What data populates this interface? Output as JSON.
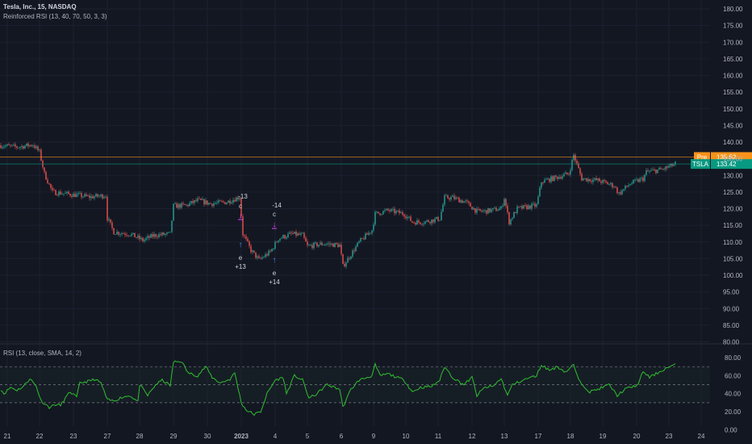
{
  "header": {
    "symbol_line": "Tesla, Inc., 15, NASDAQ",
    "indicator_line": "Reinforced RSI (13, 40, 70, 50, 3, 3)"
  },
  "rsi_pane": {
    "label": "RSI (13, close, SMA, 14, 2)"
  },
  "colors": {
    "background": "#131722",
    "up": "#26a69a",
    "down": "#ef5350",
    "rsi": "#2fbf2f",
    "pre": "#f7931a",
    "last": "#089981",
    "bear_arrow": "#e040fb",
    "bull_arrow": "#448aff"
  },
  "chart_data": [
    {
      "type": "candlestick",
      "title": "Tesla, Inc., 15, NASDAQ",
      "ylim": [
        80,
        180
      ],
      "y_ticks": [
        "180.00",
        "175.00",
        "170.00",
        "165.00",
        "160.00",
        "155.00",
        "150.00",
        "145.00",
        "140.00",
        "135.00",
        "130.00",
        "125.00",
        "120.00",
        "115.00",
        "110.00",
        "105.00",
        "100.00",
        "95.00",
        "90.00",
        "85.00",
        "80.00"
      ],
      "y_tick_values": [
        180,
        175,
        170,
        165,
        160,
        155,
        150,
        145,
        140,
        135,
        130,
        125,
        120,
        115,
        110,
        105,
        100,
        95,
        90,
        85,
        80
      ],
      "x_ticks": [
        "21",
        "22",
        "23",
        "27",
        "28",
        "29",
        "30",
        "2023",
        "4",
        "5",
        "6",
        "9",
        "10",
        "11",
        "12",
        "13",
        "17",
        "18",
        "19",
        "20",
        "23",
        "24"
      ],
      "x_tick_bars": [
        4,
        24,
        45,
        66,
        86,
        107,
        128,
        149,
        170,
        190,
        211,
        231,
        251,
        271,
        292,
        312,
        333,
        353,
        373,
        394,
        414,
        434
      ],
      "bars_total": 440,
      "close_anchors": [
        [
          0,
          139.0
        ],
        [
          10,
          138.5
        ],
        [
          20,
          139.2
        ],
        [
          24,
          137.0
        ],
        [
          27,
          130.5
        ],
        [
          32,
          125.0
        ],
        [
          40,
          124.5
        ],
        [
          48,
          124.0
        ],
        [
          55,
          123.5
        ],
        [
          65,
          124.0
        ],
        [
          66,
          117.2
        ],
        [
          70,
          113.0
        ],
        [
          80,
          112.4
        ],
        [
          88,
          110.5
        ],
        [
          95,
          112.0
        ],
        [
          105,
          112.4
        ],
        [
          107,
          120.8
        ],
        [
          115,
          121.0
        ],
        [
          122,
          122.5
        ],
        [
          130,
          121.5
        ],
        [
          140,
          122.0
        ],
        [
          148,
          123.5
        ],
        [
          150,
          112.4
        ],
        [
          155,
          107.5
        ],
        [
          160,
          104.6
        ],
        [
          167,
          107.0
        ],
        [
          172,
          111.0
        ],
        [
          180,
          112.4
        ],
        [
          187,
          112.0
        ],
        [
          190,
          108.7
        ],
        [
          200,
          109.5
        ],
        [
          210,
          109.0
        ],
        [
          212,
          102.7
        ],
        [
          218,
          107.0
        ],
        [
          222,
          109.9
        ],
        [
          230,
          113.6
        ],
        [
          232,
          118.4
        ],
        [
          240,
          119.5
        ],
        [
          250,
          118.4
        ],
        [
          255,
          116.0
        ],
        [
          262,
          116.0
        ],
        [
          272,
          117.0
        ],
        [
          275,
          123.3
        ],
        [
          280,
          123.3
        ],
        [
          288,
          122.0
        ],
        [
          295,
          119.2
        ],
        [
          300,
          119.2
        ],
        [
          310,
          120.0
        ],
        [
          312,
          123.3
        ],
        [
          315,
          116.0
        ],
        [
          320,
          120.0
        ],
        [
          332,
          121.0
        ],
        [
          335,
          128.1
        ],
        [
          345,
          129.5
        ],
        [
          352,
          130.5
        ],
        [
          355,
          136.1
        ],
        [
          360,
          129.0
        ],
        [
          370,
          128.5
        ],
        [
          380,
          126.9
        ],
        [
          383,
          124.5
        ],
        [
          390,
          127.5
        ],
        [
          398,
          129.0
        ],
        [
          400,
          131.0
        ],
        [
          410,
          131.8
        ],
        [
          418,
          133.42
        ]
      ],
      "price_lines": [
        {
          "label": "Pre",
          "value": 135.52,
          "value_text": "135.52"
        },
        {
          "label": "TSLA",
          "value": 133.42,
          "value_text": "133.42"
        }
      ],
      "annotations": [
        {
          "top": "-13",
          "mid": "c",
          "bottom_letter": "e",
          "bottom": "+13"
        },
        {
          "top": "-14",
          "mid": "c",
          "bottom_letter": "e",
          "bottom": "+14"
        }
      ]
    },
    {
      "type": "line",
      "title": "RSI (13, close, SMA, 14, 2)",
      "ylim": [
        0,
        80
      ],
      "y_ticks": [
        "80.00",
        "60.00",
        "40.00",
        "20.00",
        "0.00"
      ],
      "y_tick_values": [
        80,
        60,
        40,
        20,
        0
      ],
      "bands": [
        70,
        50,
        30
      ],
      "rsi_anchors": [
        [
          0,
          45
        ],
        [
          2,
          40
        ],
        [
          6,
          47
        ],
        [
          10,
          44
        ],
        [
          14,
          48
        ],
        [
          18,
          57
        ],
        [
          22,
          48
        ],
        [
          25,
          32
        ],
        [
          30,
          25
        ],
        [
          34,
          28
        ],
        [
          37,
          27
        ],
        [
          40,
          35
        ],
        [
          43,
          42
        ],
        [
          47,
          36
        ],
        [
          49,
          52
        ],
        [
          55,
          54
        ],
        [
          58,
          56
        ],
        [
          62,
          52
        ],
        [
          66,
          33
        ],
        [
          70,
          32
        ],
        [
          75,
          36
        ],
        [
          80,
          38
        ],
        [
          85,
          31
        ],
        [
          86,
          50
        ],
        [
          91,
          38
        ],
        [
          96,
          50
        ],
        [
          100,
          55
        ],
        [
          105,
          49
        ],
        [
          107,
          75
        ],
        [
          112,
          76
        ],
        [
          116,
          63
        ],
        [
          122,
          60
        ],
        [
          127,
          70
        ],
        [
          131,
          58
        ],
        [
          136,
          52
        ],
        [
          142,
          56
        ],
        [
          145,
          63
        ],
        [
          149,
          30
        ],
        [
          152,
          22
        ],
        [
          157,
          17
        ],
        [
          161,
          20
        ],
        [
          165,
          40
        ],
        [
          170,
          55
        ],
        [
          175,
          58
        ],
        [
          177,
          40
        ],
        [
          182,
          60
        ],
        [
          187,
          55
        ],
        [
          191,
          35
        ],
        [
          196,
          40
        ],
        [
          202,
          50
        ],
        [
          210,
          45
        ],
        [
          212,
          25
        ],
        [
          217,
          45
        ],
        [
          222,
          55
        ],
        [
          230,
          60
        ],
        [
          232,
          72
        ],
        [
          235,
          60
        ],
        [
          240,
          62
        ],
        [
          250,
          55
        ],
        [
          255,
          42
        ],
        [
          260,
          47
        ],
        [
          267,
          48
        ],
        [
          272,
          55
        ],
        [
          275,
          70
        ],
        [
          280,
          58
        ],
        [
          287,
          50
        ],
        [
          292,
          58
        ],
        [
          295,
          38
        ],
        [
          300,
          47
        ],
        [
          305,
          48
        ],
        [
          310,
          57
        ],
        [
          314,
          38
        ],
        [
          317,
          50
        ],
        [
          325,
          56
        ],
        [
          332,
          60
        ],
        [
          335,
          72
        ],
        [
          340,
          66
        ],
        [
          345,
          70
        ],
        [
          350,
          64
        ],
        [
          355,
          72
        ],
        [
          358,
          55
        ],
        [
          365,
          42
        ],
        [
          370,
          45
        ],
        [
          377,
          50
        ],
        [
          382,
          38
        ],
        [
          387,
          45
        ],
        [
          395,
          50
        ],
        [
          398,
          65
        ],
        [
          402,
          58
        ],
        [
          407,
          63
        ],
        [
          412,
          68
        ],
        [
          418,
          72
        ]
      ]
    }
  ]
}
